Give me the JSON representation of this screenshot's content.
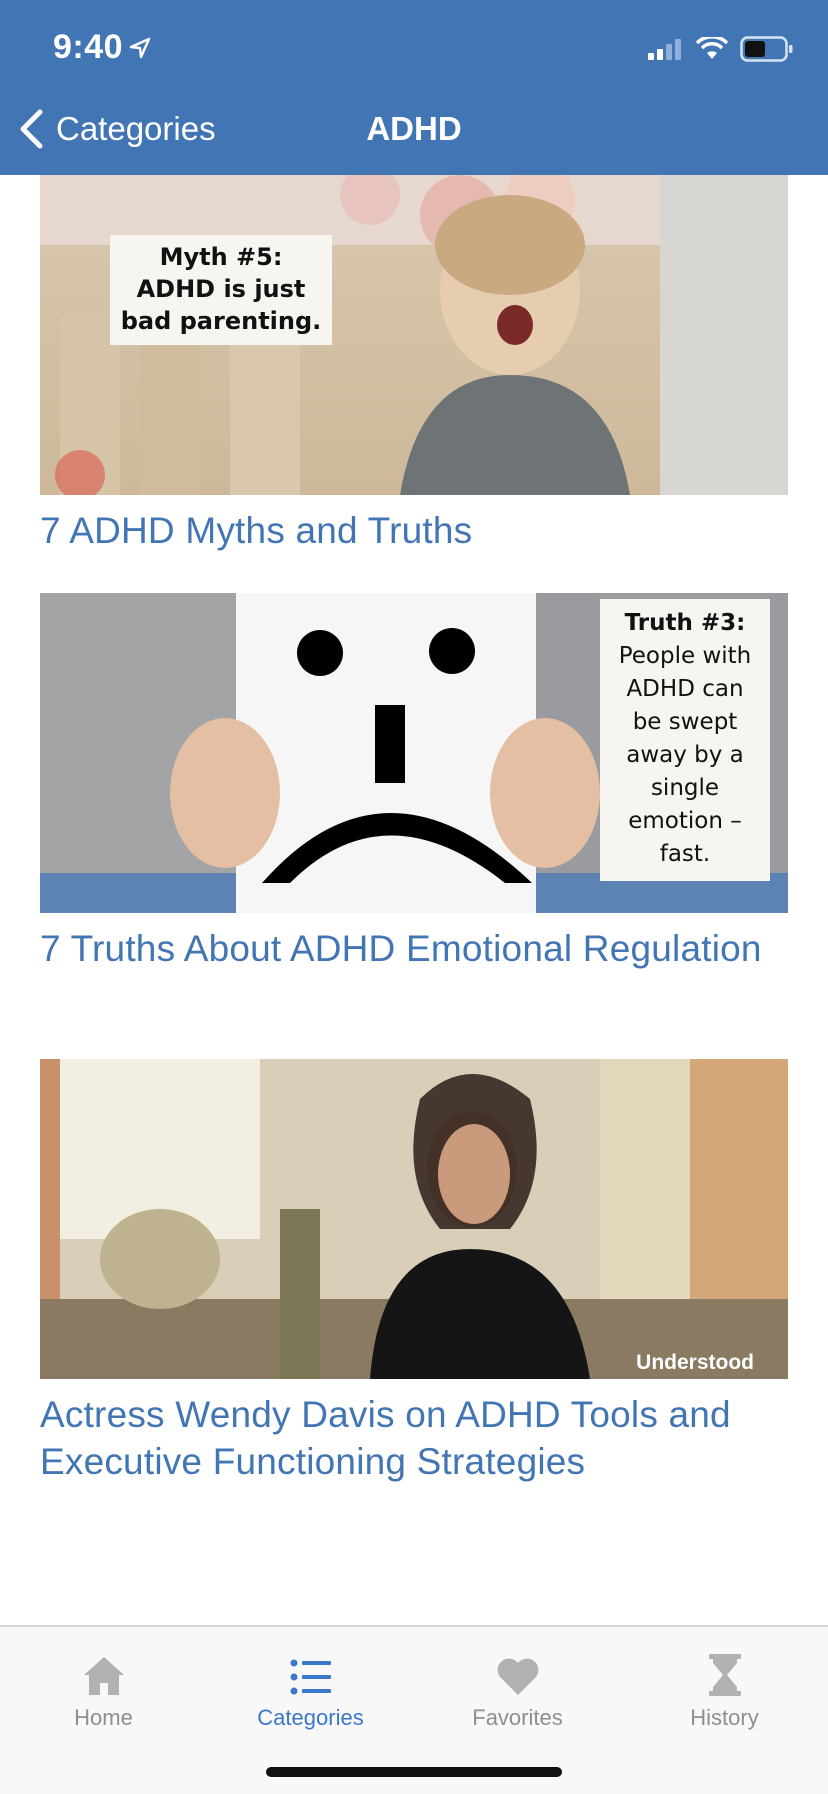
{
  "status": {
    "time": "9:40"
  },
  "nav": {
    "back_label": "Categories",
    "title": "ADHD"
  },
  "articles": [
    {
      "title": "7 ADHD Myths and Truths",
      "image_caption": [
        "Myth #5:",
        "ADHD is just",
        "bad parenting."
      ]
    },
    {
      "title": "7 Truths About ADHD Emotional Regulation",
      "image_caption": [
        "Truth #3:",
        "People with",
        "ADHD can",
        "be swept",
        "away by a",
        "single",
        "emotion –",
        "fast."
      ]
    },
    {
      "title": "Actress Wendy Davis on ADHD Tools and Executive Functioning Strategies",
      "image_watermark": "Understood"
    }
  ],
  "tabs": [
    {
      "label": "Home",
      "icon": "home-icon"
    },
    {
      "label": "Categories",
      "icon": "list-icon",
      "active": true
    },
    {
      "label": "Favorites",
      "icon": "heart-icon"
    },
    {
      "label": "History",
      "icon": "hourglass-icon"
    }
  ],
  "colors": {
    "brand": "#4275b4",
    "active_tab": "#3a78c9",
    "inactive_tab": "#8e8e93"
  }
}
